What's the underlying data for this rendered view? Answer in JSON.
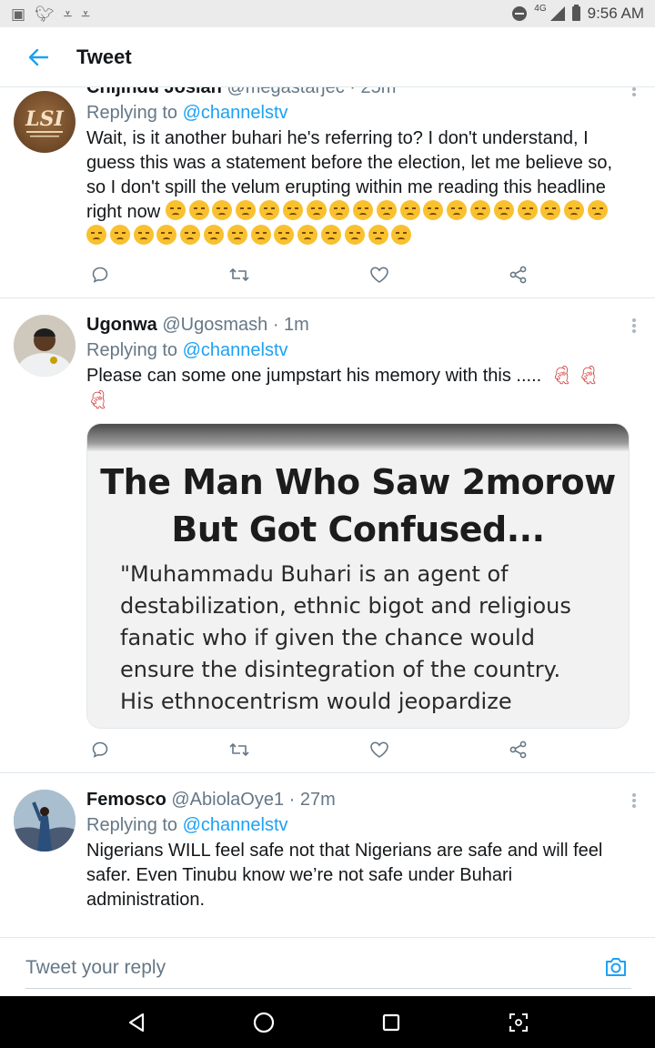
{
  "status_bar": {
    "network": "4G",
    "time": "9:56 AM"
  },
  "header": {
    "title": "Tweet"
  },
  "tweets": [
    {
      "name": "Chijindu Josiah",
      "handle": "@megastarjec",
      "time": "· 25m",
      "replying_prefix": "Replying to",
      "replying_to": "@channelstv",
      "text": "Wait, is it another buhari he's referring to? I don't understand, I guess this was a statement before the election, let me believe so, so I don't spill the velum erupting within me reading this headline right now",
      "emoji_count": 33,
      "emoji_name": "angry-face-emoji",
      "avatar_text": "LSI"
    },
    {
      "name": "Ugonwa",
      "handle": "@Ugosmash",
      "time": "· 1m",
      "replying_prefix": "Replying to",
      "replying_to": "@channelstv",
      "text": "Please can some one jumpstart his memory with this .....",
      "emoji_count": 3,
      "emoji_name": "dancer-emoji",
      "media": {
        "title_line1": "The Man Who Saw 2morow",
        "title_line2": "But Got Confused...",
        "quote_lines": [
          "\"Muhammadu Buhari is an agent of",
          "destabilization, ethnic bigot and religious",
          "fanatic who if given the chance would",
          "ensure the disintegration of the country.",
          "His ethnocentrism would jeopardize"
        ]
      }
    },
    {
      "name": "Femosco",
      "handle": "@AbiolaOye1",
      "time": "· 27m",
      "replying_prefix": "Replying to",
      "replying_to": "@channelstv",
      "text": "Nigerians WILL feel safe not that Nigerians are safe and will feel safer. Even Tinubu know we’re not safe under Buhari administration."
    }
  ],
  "reply_bar": {
    "placeholder": "Tweet your reply"
  },
  "colors": {
    "accent": "#1da1f2",
    "muted": "#657786",
    "divider": "#e1e8ed"
  }
}
